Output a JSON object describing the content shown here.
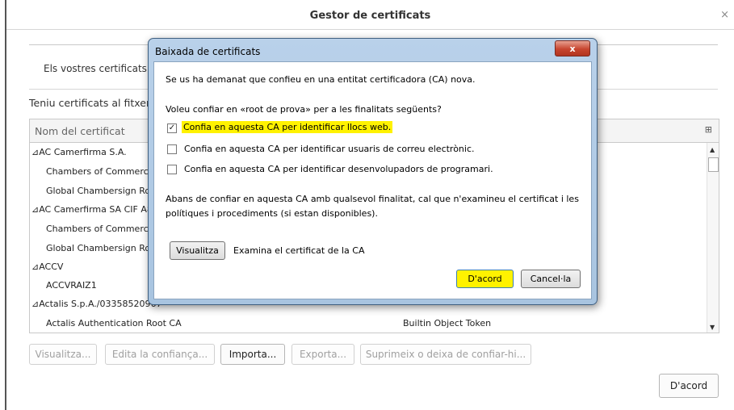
{
  "window": {
    "title": "Gestor de certificats",
    "close_glyph": "×"
  },
  "tabs": {
    "your_certs": "Els vostres certificats"
  },
  "intro": "Teniu certificats al fitxer q",
  "tree": {
    "column_name": "Nom del certificat",
    "rows": [
      {
        "label": "⊿AC Camerfirma S.A.",
        "token": ""
      },
      {
        "label": "Chambers of Commerce",
        "token": ""
      },
      {
        "label": "Global Chambersign Roo",
        "token": ""
      },
      {
        "label": "⊿AC Camerfirma SA CIF A82",
        "token": ""
      },
      {
        "label": "Chambers of Commerce",
        "token": ""
      },
      {
        "label": "Global Chambersign Roo",
        "token": ""
      },
      {
        "label": "⊿ACCV",
        "token": ""
      },
      {
        "label": "ACCVRAIZ1",
        "token": ""
      },
      {
        "label": "⊿Actalis S.p.A./03358520967",
        "token": ""
      },
      {
        "label": "Actalis Authentication Root CA",
        "token": "Builtin Object Token"
      }
    ]
  },
  "buttons": {
    "view": "Visualitza...",
    "edit_trust": "Edita la confiança...",
    "import": "Importa...",
    "export": "Exporta...",
    "delete": "Suprimeix o deixa de confiar-hi...",
    "ok": "D'acord"
  },
  "dialog": {
    "title": "Baixada de certificats",
    "close_glyph": "x",
    "line1": "Se us ha demanat que confieu en una entitat certificadora (CA) nova.",
    "line2": "Voleu confiar en «root de prova» per a les finalitats següents?",
    "options": [
      {
        "label": "Confia en aquesta CA per identificar llocs web.",
        "checked": true
      },
      {
        "label": "Confia en aquesta CA per identificar usuaris de correu electrònic.",
        "checked": false
      },
      {
        "label": "Confia en aquesta CA per identificar desenvolupadors de programari.",
        "checked": false
      }
    ],
    "note_line1": "Abans de confiar en aquesta CA amb qualsevol finalitat, cal que n'examineu el certificat i les",
    "note_line2": "polítiques i procediments (si estan disponibles).",
    "view_button": "Visualitza",
    "view_desc": "Examina el certificat de la CA",
    "ok_button": "D'acord",
    "cancel_button": "Cancel·la"
  },
  "colors": {
    "highlight": "#fff200",
    "dialog_frame": "#a8c4e0"
  }
}
